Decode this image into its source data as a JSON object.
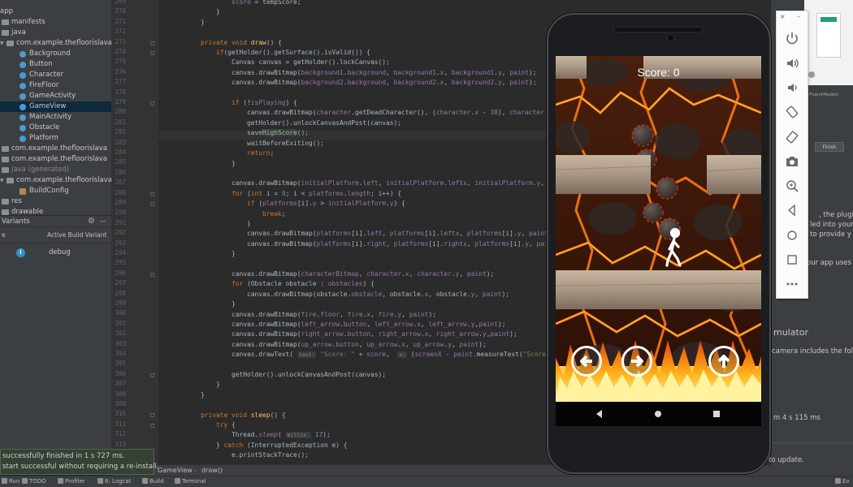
{
  "project_tree": {
    "rows": [
      {
        "label": "app",
        "kind": "root"
      },
      {
        "label": "manifests",
        "kind": "folder"
      },
      {
        "label": "java",
        "kind": "folder"
      },
      {
        "label": "com.example.thefloorislava",
        "kind": "package"
      },
      {
        "label": "Background",
        "kind": "class"
      },
      {
        "label": "Button",
        "kind": "class"
      },
      {
        "label": "Character",
        "kind": "class"
      },
      {
        "label": "FireFloor",
        "kind": "class"
      },
      {
        "label": "GameActivity",
        "kind": "class"
      },
      {
        "label": "GameView",
        "kind": "class",
        "selected": true
      },
      {
        "label": "MainActivity",
        "kind": "class"
      },
      {
        "label": "Obstacle",
        "kind": "class"
      },
      {
        "label": "Platform",
        "kind": "class"
      },
      {
        "label": "com.example.thefloorislava",
        "kind": "package"
      },
      {
        "label": "com.example.thefloorislava",
        "kind": "package"
      },
      {
        "label": "java (generated)",
        "kind": "folder"
      },
      {
        "label": "com.example.thefloorislava",
        "kind": "package"
      },
      {
        "label": "BuildConfig",
        "kind": "gen"
      },
      {
        "label": "res",
        "kind": "folder"
      },
      {
        "label": "drawable",
        "kind": "folder"
      }
    ]
  },
  "build_variants": {
    "title": "Variants",
    "col_module": "e",
    "col_variant": "Active Build Variant",
    "row_value": "debug"
  },
  "editor": {
    "line_numbers": [
      "269",
      "270",
      "271",
      "272",
      "273",
      "274",
      "275",
      "276",
      "277",
      "278",
      "279",
      "280",
      "281",
      "282",
      "283",
      "284",
      "285",
      "286",
      "287",
      "288",
      "289",
      "290",
      "291",
      "292",
      "293",
      "294",
      "295",
      "296",
      "297",
      "298",
      "299",
      "300",
      "301",
      "302",
      "303",
      "304",
      "305",
      "306",
      "307",
      "308",
      "309",
      "310",
      "311",
      "312",
      "313",
      "314",
      "315"
    ]
  },
  "breadcrumb": {
    "items": [
      "GameView",
      "draw()"
    ]
  },
  "tool_tabs": [
    {
      "label": "Run",
      "icon": "run-icon"
    },
    {
      "label": "TODO",
      "icon": "todo-icon"
    },
    {
      "label": "Profiler",
      "icon": "profiler-icon"
    },
    {
      "label": "6: Logcat",
      "icon": "logcat-icon"
    },
    {
      "label": "Build",
      "icon": "build-icon"
    },
    {
      "label": "Terminal",
      "icon": "terminal-icon"
    }
  ],
  "notification": {
    "line1": "successfully finished in 1 s 727 ms.",
    "line2": "start successful without requiring a re-install."
  },
  "right_panel": {
    "texts": [
      "FluentModel)",
      "Finish",
      ", the plugin",
      "led into your a",
      "to provide y",
      "our app uses",
      "mulator",
      "camera includes the follo",
      "m 4 s 115 ms",
      "to update."
    ]
  },
  "emulator_toolbar": {
    "close_label": "×",
    "minimize_label": "–",
    "buttons": [
      "power-icon",
      "volume-up-icon",
      "volume-down-icon",
      "rotate-left-icon",
      "rotate-right-icon",
      "screenshot-icon",
      "zoom-icon",
      "back-icon",
      "home-icon",
      "overview-icon",
      "more-icon"
    ]
  },
  "game": {
    "score_text": "Score: 0",
    "controls": [
      "left-arrow-button",
      "right-arrow-button",
      "up-arrow-button"
    ]
  },
  "status_bar": {
    "right_text": "Ev"
  }
}
